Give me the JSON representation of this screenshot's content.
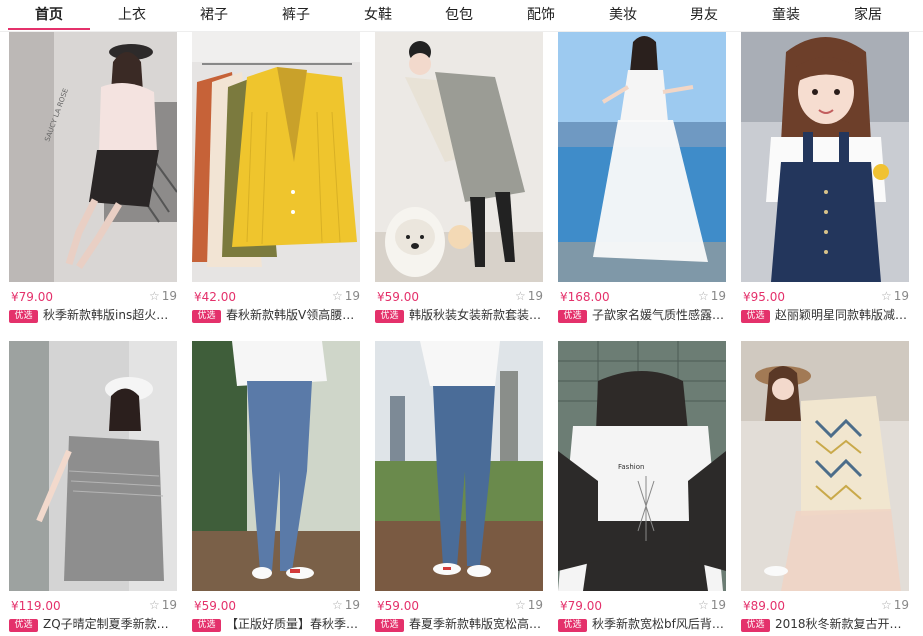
{
  "tabs": [
    {
      "label": "首页"
    },
    {
      "label": "上衣"
    },
    {
      "label": "裙子"
    },
    {
      "label": "裤子"
    },
    {
      "label": "女鞋"
    },
    {
      "label": "包包"
    },
    {
      "label": "配饰"
    },
    {
      "label": "美妆"
    },
    {
      "label": "男友"
    },
    {
      "label": "童装"
    },
    {
      "label": "家居"
    }
  ],
  "accent_color": "#e4316b",
  "badge_label": "优选",
  "products": [
    {
      "price": "¥79.00",
      "likes": "19",
      "title": "秋季新款韩版ins超火…",
      "image": "model-pink-blouse-black-skirt"
    },
    {
      "price": "¥42.00",
      "likes": "19",
      "title": "春秋新款韩版V领高腰…",
      "image": "yellow-cardigan-on-hangers"
    },
    {
      "price": "¥59.00",
      "likes": "19",
      "title": "韩版秋装女装新款套装…",
      "image": "grey-vest-dress-with-dog"
    },
    {
      "price": "¥168.00",
      "likes": "19",
      "title": "子歆家名媛气质性感露…",
      "image": "white-dress-by-lake"
    },
    {
      "price": "¥95.00",
      "likes": "19",
      "title": "赵丽颖明星同款韩版减…",
      "image": "denim-overall-dress"
    },
    {
      "price": "¥119.00",
      "likes": "19",
      "title": "ZQ子晴定制夏季新款…",
      "image": "grey-fringe-tshirt-dress"
    },
    {
      "price": "¥59.00",
      "likes": "19",
      "title": "【正版好质量】春秋季…",
      "image": "slit-hem-jeans-white-sneakers"
    },
    {
      "price": "¥59.00",
      "likes": "19",
      "title": "春夏季新款韩版宽松高…",
      "image": "straight-jeans-city-view"
    },
    {
      "price": "¥79.00",
      "likes": "19",
      "title": "秋季新款宽松bf风后背…",
      "image": "white-bomber-jacket-back"
    },
    {
      "price": "¥89.00",
      "likes": "19",
      "title": "2018秋冬新款复古开…",
      "image": "knit-cardigan-tulle-skirt"
    }
  ]
}
